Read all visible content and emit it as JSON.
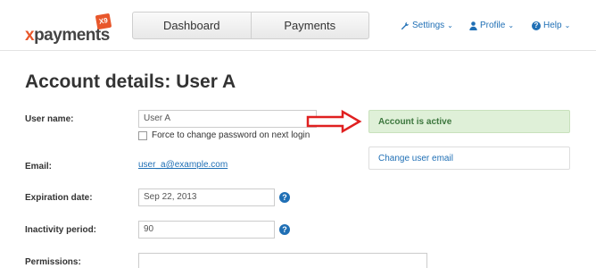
{
  "logo": {
    "prefix": "x",
    "text": "payments",
    "badge": "X9"
  },
  "nav": {
    "tabs": [
      {
        "label": "Dashboard"
      },
      {
        "label": "Payments"
      }
    ]
  },
  "menus": {
    "settings": "Settings",
    "profile": "Profile",
    "help": "Help"
  },
  "page": {
    "title": "Account details: User A"
  },
  "form": {
    "username_label": "User name:",
    "username_value": "User A",
    "force_change_label": "Force to change password on next login",
    "email_label": "Email:",
    "email_value": "user_a@example.com",
    "expiration_label": "Expiration date:",
    "expiration_value": "Sep 22, 2013",
    "inactivity_label": "Inactivity period:",
    "inactivity_value": "90",
    "permissions_label": "Permissions:",
    "help_glyph": "?"
  },
  "status": {
    "text": "Account is active",
    "color": "#dff0d8"
  },
  "actions": {
    "change_email": "Change user email"
  },
  "colors": {
    "accent": "#1f6fb5",
    "brand": "#e8572b",
    "arrow": "#e02020"
  }
}
